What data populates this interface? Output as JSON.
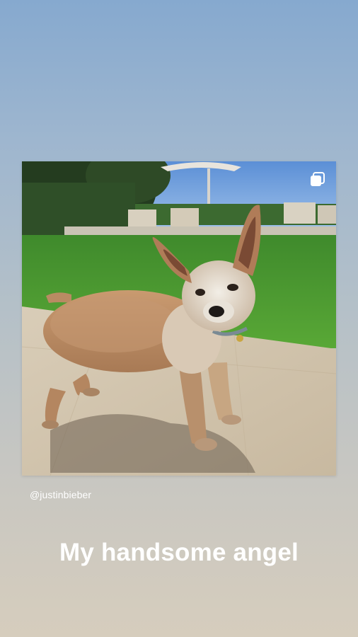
{
  "story": {
    "post": {
      "image_icon": "dog-photo",
      "overlay_icon": "multiple-images-icon"
    },
    "username": "@justinbieber",
    "caption": "My handsome angel",
    "colors": {
      "background_top": "#86a9cf",
      "background_bottom": "#d6cdbd",
      "text": "#ffffff"
    }
  }
}
